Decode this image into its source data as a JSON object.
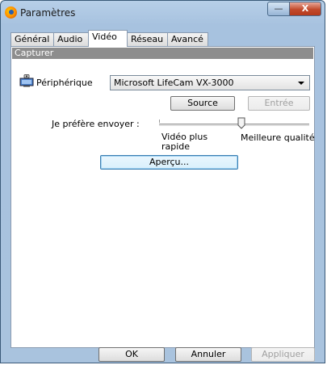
{
  "window": {
    "title": "Paramètres",
    "minimize_glyph": "—",
    "close_glyph": "X"
  },
  "tabs": [
    {
      "label": "Général"
    },
    {
      "label": "Audio"
    },
    {
      "label": "Vidéo",
      "active": true
    },
    {
      "label": "Réseau"
    },
    {
      "label": "Avancé"
    }
  ],
  "section": {
    "title": "Capturer"
  },
  "device": {
    "label": "Périphérique",
    "selected": "Microsoft LifeCam VX-3000",
    "icon": "webcam-monitor-icon"
  },
  "buttons": {
    "source": "Source",
    "input": "Entrée",
    "preview": "Aperçu..."
  },
  "preference": {
    "label": "Je préfère envoyer :",
    "left_label": "Vidéo plus rapide",
    "right_label": "Meilleure qualité",
    "value_fraction": 0.55
  },
  "footer": {
    "ok": "OK",
    "cancel": "Annuler",
    "apply": "Appliquer"
  },
  "colors": {
    "frame": "#a9c3de",
    "section_header": "#8d8d8d",
    "focus_border": "#3c7fb1"
  }
}
